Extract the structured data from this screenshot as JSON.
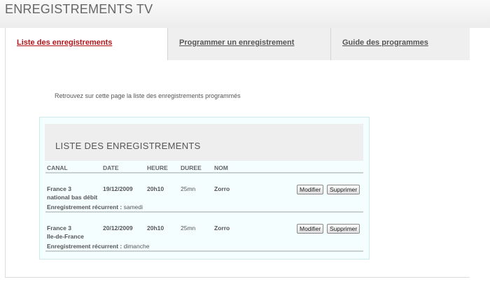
{
  "page": {
    "title": "ENREGISTREMENTS TV"
  },
  "tabs": [
    {
      "label": "Liste des enregistrements",
      "active": true
    },
    {
      "label": "Programmer un enregistrement",
      "active": false
    },
    {
      "label": "Guide des programmes",
      "active": false
    }
  ],
  "intro": "Retrouvez sur cette page la liste des enregistrements programmés",
  "list": {
    "title": "LISTE DES ENREGISTREMENTS",
    "columns": [
      "CANAL",
      "DATE",
      "HEURE",
      "DUREE",
      "NOM"
    ],
    "recurrent_label": "Enregistrement récurrent :",
    "modify_label": "Modifier",
    "delete_label": "Supprimer",
    "rows": [
      {
        "channel_line1": "France 3",
        "channel_line2": "national bas débit",
        "date": "19/12/2009",
        "time": "20h10",
        "duration": "25mn",
        "name": "Zorro",
        "recurrence": "samedi"
      },
      {
        "channel_line1": "France 3",
        "channel_line2": "Ile-de-France",
        "date": "20/12/2009",
        "time": "20h10",
        "duration": "25mn",
        "name": "Zorro",
        "recurrence": "dimanche"
      }
    ]
  },
  "colors": {
    "active_tab": "#b0161a",
    "panel_bg": "#f4fefe",
    "header_bg": "#eeeeee"
  }
}
